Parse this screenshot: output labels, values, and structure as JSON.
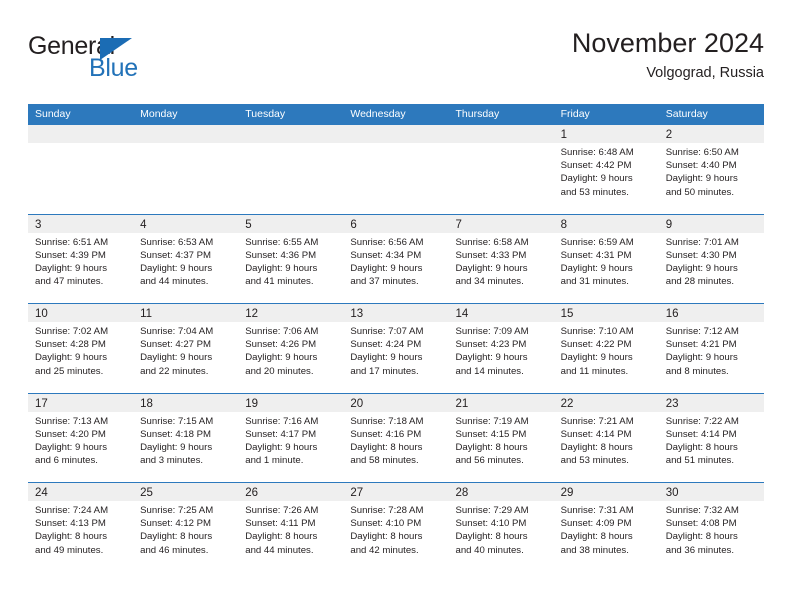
{
  "brand": {
    "name_part1": "General",
    "name_part2": "Blue",
    "triangle_color": "#1b6cb4",
    "accent_color": "#2272b8"
  },
  "header": {
    "title": "November 2024",
    "subtitle": "Volgograd, Russia",
    "header_bg": "#2d79bd",
    "daynum_bg": "#efefef"
  },
  "weekday_headers": [
    "Sunday",
    "Monday",
    "Tuesday",
    "Wednesday",
    "Thursday",
    "Friday",
    "Saturday"
  ],
  "weeks": [
    [
      {
        "day": "",
        "sunrise": "",
        "sunset": "",
        "daylight1": "",
        "daylight2": ""
      },
      {
        "day": "",
        "sunrise": "",
        "sunset": "",
        "daylight1": "",
        "daylight2": ""
      },
      {
        "day": "",
        "sunrise": "",
        "sunset": "",
        "daylight1": "",
        "daylight2": ""
      },
      {
        "day": "",
        "sunrise": "",
        "sunset": "",
        "daylight1": "",
        "daylight2": ""
      },
      {
        "day": "",
        "sunrise": "",
        "sunset": "",
        "daylight1": "",
        "daylight2": ""
      },
      {
        "day": "1",
        "sunrise": "Sunrise: 6:48 AM",
        "sunset": "Sunset: 4:42 PM",
        "daylight1": "Daylight: 9 hours",
        "daylight2": "and 53 minutes."
      },
      {
        "day": "2",
        "sunrise": "Sunrise: 6:50 AM",
        "sunset": "Sunset: 4:40 PM",
        "daylight1": "Daylight: 9 hours",
        "daylight2": "and 50 minutes."
      }
    ],
    [
      {
        "day": "3",
        "sunrise": "Sunrise: 6:51 AM",
        "sunset": "Sunset: 4:39 PM",
        "daylight1": "Daylight: 9 hours",
        "daylight2": "and 47 minutes."
      },
      {
        "day": "4",
        "sunrise": "Sunrise: 6:53 AM",
        "sunset": "Sunset: 4:37 PM",
        "daylight1": "Daylight: 9 hours",
        "daylight2": "and 44 minutes."
      },
      {
        "day": "5",
        "sunrise": "Sunrise: 6:55 AM",
        "sunset": "Sunset: 4:36 PM",
        "daylight1": "Daylight: 9 hours",
        "daylight2": "and 41 minutes."
      },
      {
        "day": "6",
        "sunrise": "Sunrise: 6:56 AM",
        "sunset": "Sunset: 4:34 PM",
        "daylight1": "Daylight: 9 hours",
        "daylight2": "and 37 minutes."
      },
      {
        "day": "7",
        "sunrise": "Sunrise: 6:58 AM",
        "sunset": "Sunset: 4:33 PM",
        "daylight1": "Daylight: 9 hours",
        "daylight2": "and 34 minutes."
      },
      {
        "day": "8",
        "sunrise": "Sunrise: 6:59 AM",
        "sunset": "Sunset: 4:31 PM",
        "daylight1": "Daylight: 9 hours",
        "daylight2": "and 31 minutes."
      },
      {
        "day": "9",
        "sunrise": "Sunrise: 7:01 AM",
        "sunset": "Sunset: 4:30 PM",
        "daylight1": "Daylight: 9 hours",
        "daylight2": "and 28 minutes."
      }
    ],
    [
      {
        "day": "10",
        "sunrise": "Sunrise: 7:02 AM",
        "sunset": "Sunset: 4:28 PM",
        "daylight1": "Daylight: 9 hours",
        "daylight2": "and 25 minutes."
      },
      {
        "day": "11",
        "sunrise": "Sunrise: 7:04 AM",
        "sunset": "Sunset: 4:27 PM",
        "daylight1": "Daylight: 9 hours",
        "daylight2": "and 22 minutes."
      },
      {
        "day": "12",
        "sunrise": "Sunrise: 7:06 AM",
        "sunset": "Sunset: 4:26 PM",
        "daylight1": "Daylight: 9 hours",
        "daylight2": "and 20 minutes."
      },
      {
        "day": "13",
        "sunrise": "Sunrise: 7:07 AM",
        "sunset": "Sunset: 4:24 PM",
        "daylight1": "Daylight: 9 hours",
        "daylight2": "and 17 minutes."
      },
      {
        "day": "14",
        "sunrise": "Sunrise: 7:09 AM",
        "sunset": "Sunset: 4:23 PM",
        "daylight1": "Daylight: 9 hours",
        "daylight2": "and 14 minutes."
      },
      {
        "day": "15",
        "sunrise": "Sunrise: 7:10 AM",
        "sunset": "Sunset: 4:22 PM",
        "daylight1": "Daylight: 9 hours",
        "daylight2": "and 11 minutes."
      },
      {
        "day": "16",
        "sunrise": "Sunrise: 7:12 AM",
        "sunset": "Sunset: 4:21 PM",
        "daylight1": "Daylight: 9 hours",
        "daylight2": "and 8 minutes."
      }
    ],
    [
      {
        "day": "17",
        "sunrise": "Sunrise: 7:13 AM",
        "sunset": "Sunset: 4:20 PM",
        "daylight1": "Daylight: 9 hours",
        "daylight2": "and 6 minutes."
      },
      {
        "day": "18",
        "sunrise": "Sunrise: 7:15 AM",
        "sunset": "Sunset: 4:18 PM",
        "daylight1": "Daylight: 9 hours",
        "daylight2": "and 3 minutes."
      },
      {
        "day": "19",
        "sunrise": "Sunrise: 7:16 AM",
        "sunset": "Sunset: 4:17 PM",
        "daylight1": "Daylight: 9 hours",
        "daylight2": "and 1 minute."
      },
      {
        "day": "20",
        "sunrise": "Sunrise: 7:18 AM",
        "sunset": "Sunset: 4:16 PM",
        "daylight1": "Daylight: 8 hours",
        "daylight2": "and 58 minutes."
      },
      {
        "day": "21",
        "sunrise": "Sunrise: 7:19 AM",
        "sunset": "Sunset: 4:15 PM",
        "daylight1": "Daylight: 8 hours",
        "daylight2": "and 56 minutes."
      },
      {
        "day": "22",
        "sunrise": "Sunrise: 7:21 AM",
        "sunset": "Sunset: 4:14 PM",
        "daylight1": "Daylight: 8 hours",
        "daylight2": "and 53 minutes."
      },
      {
        "day": "23",
        "sunrise": "Sunrise: 7:22 AM",
        "sunset": "Sunset: 4:14 PM",
        "daylight1": "Daylight: 8 hours",
        "daylight2": "and 51 minutes."
      }
    ],
    [
      {
        "day": "24",
        "sunrise": "Sunrise: 7:24 AM",
        "sunset": "Sunset: 4:13 PM",
        "daylight1": "Daylight: 8 hours",
        "daylight2": "and 49 minutes."
      },
      {
        "day": "25",
        "sunrise": "Sunrise: 7:25 AM",
        "sunset": "Sunset: 4:12 PM",
        "daylight1": "Daylight: 8 hours",
        "daylight2": "and 46 minutes."
      },
      {
        "day": "26",
        "sunrise": "Sunrise: 7:26 AM",
        "sunset": "Sunset: 4:11 PM",
        "daylight1": "Daylight: 8 hours",
        "daylight2": "and 44 minutes."
      },
      {
        "day": "27",
        "sunrise": "Sunrise: 7:28 AM",
        "sunset": "Sunset: 4:10 PM",
        "daylight1": "Daylight: 8 hours",
        "daylight2": "and 42 minutes."
      },
      {
        "day": "28",
        "sunrise": "Sunrise: 7:29 AM",
        "sunset": "Sunset: 4:10 PM",
        "daylight1": "Daylight: 8 hours",
        "daylight2": "and 40 minutes."
      },
      {
        "day": "29",
        "sunrise": "Sunrise: 7:31 AM",
        "sunset": "Sunset: 4:09 PM",
        "daylight1": "Daylight: 8 hours",
        "daylight2": "and 38 minutes."
      },
      {
        "day": "30",
        "sunrise": "Sunrise: 7:32 AM",
        "sunset": "Sunset: 4:08 PM",
        "daylight1": "Daylight: 8 hours",
        "daylight2": "and 36 minutes."
      }
    ]
  ]
}
